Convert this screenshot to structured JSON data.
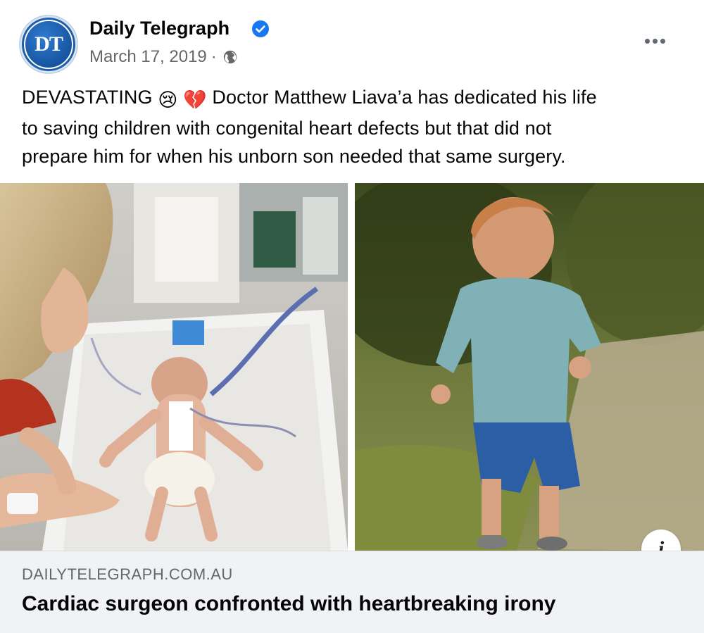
{
  "post": {
    "avatar_text": "DT",
    "page_name": "Daily Telegraph",
    "date": "March 17, 2019",
    "separator": "·",
    "privacy_icon": "globe-icon",
    "verified_icon": "verified-badge-icon",
    "more_icon": "more-options-icon",
    "text": {
      "part1": "DEVASTATING ",
      "part2": " Doctor Matthew Liava’a has dedicated his life",
      "line2": "to saving children with congenital heart defects but that did not",
      "line3": "prepare him for when his unborn son needed that same surgery.",
      "emoji1": "😢",
      "emoji2": "💔"
    }
  },
  "media": {
    "left_photo": "hospital-baby-photo",
    "right_photo": "toddler-walking-photo",
    "info_icon": "info-icon",
    "info_glyph": "i"
  },
  "link_preview": {
    "domain": "DAILYTELEGRAPH.COM.AU",
    "headline": "Cardiac surgeon confronted with heartbreaking irony"
  },
  "colors": {
    "accent": "#1877f2",
    "brand_avatar": "#1c5fa8",
    "secondary_text": "#65676b",
    "preview_bg": "#f0f2f5"
  }
}
